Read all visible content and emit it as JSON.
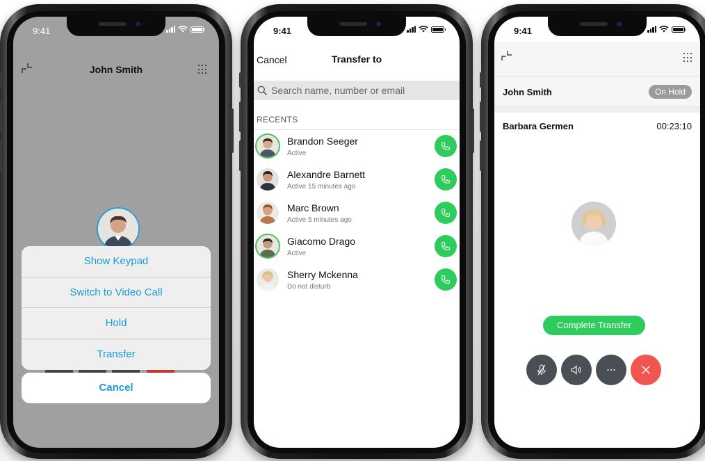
{
  "phone1": {
    "time": "9:41",
    "contact_name": "John Smith",
    "sheet_items": [
      {
        "label": "Show Keypad"
      },
      {
        "label": "Switch to Video Call"
      },
      {
        "label": "Hold"
      },
      {
        "label": "Transfer"
      }
    ],
    "cancel_label": "Cancel"
  },
  "phone2": {
    "time": "9:41",
    "cancel_label": "Cancel",
    "title": "Transfer to",
    "search_placeholder": "Search name, number or email",
    "recents_label": "RECENTS",
    "contacts": [
      {
        "name": "Brandon Seeger",
        "status": "Active",
        "ring": true
      },
      {
        "name": "Alexandre Barnett",
        "status": "Active 15 minutes ago",
        "ring": false
      },
      {
        "name": "Marc Brown",
        "status": "Active 5 minutes ago",
        "ring": false
      },
      {
        "name": "Giacomo Drago",
        "status": "Active",
        "ring": true
      },
      {
        "name": "Sherry Mckenna",
        "status": "Do not disturb",
        "ring": false
      }
    ]
  },
  "phone3": {
    "time": "9:41",
    "held_name": "John Smith",
    "hold_badge": "On Hold",
    "active_name": "Barbara Germen",
    "duration": "00:23:10",
    "complete_label": "Complete Transfer"
  },
  "colors": {
    "accent_blue": "#1a9bd7",
    "call_green": "#2ecc5c",
    "end_red": "#f0564f",
    "control_dark": "#4a4e55"
  },
  "icons": [
    "minimize-icon",
    "keypad-icon",
    "search-icon",
    "phone-icon",
    "mute-icon",
    "speaker-icon",
    "more-icon",
    "close-icon"
  ]
}
